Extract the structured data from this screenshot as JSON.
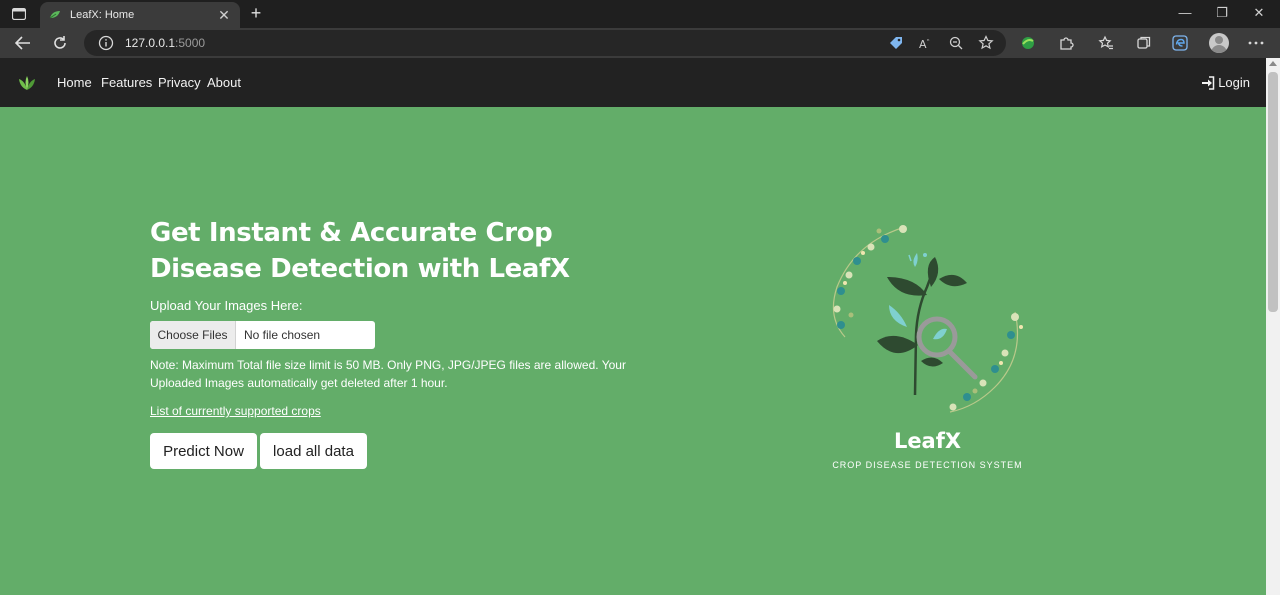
{
  "browser": {
    "tab_title": "LeafX: Home",
    "tab_close": "✕",
    "new_tab": "+",
    "url_host": "127.0.0.1",
    "url_port": ":5000",
    "window_controls": {
      "minimize": "—",
      "restore": "❐",
      "close": "✕"
    },
    "icons": [
      "tab-actions-icon",
      "back-arrow-icon",
      "refresh-icon",
      "site-info-icon",
      "tag-icon",
      "read-aloud-icon",
      "zoom-icon",
      "add-favorite-icon",
      "extension-icon",
      "puzzle-icon",
      "favorites-icon",
      "collections-icon",
      "edge-icon",
      "profile-icon",
      "more-icon"
    ]
  },
  "navbar": {
    "links": [
      "Home",
      "Features",
      "Privacy",
      "About"
    ],
    "login_label": "Login"
  },
  "hero": {
    "headline": "Get Instant & Accurate Crop Disease Detection with LeafX",
    "upload_label": "Upload Your Images Here:",
    "choose_files_label": "Choose Files",
    "file_status": "No file chosen",
    "note": "Note: Maximum Total file size limit is 50 MB. Only PNG, JPG/JPEG files are allowed. Your Uploaded Images automatically get deleted after 1 hour.",
    "crops_link": "List of currently supported crops",
    "predict_button": "Predict Now",
    "load_button": "load all data"
  },
  "logo": {
    "wordmark": "LeafX",
    "tagline": "CROP DISEASE DETECTION SYSTEM"
  },
  "colors": {
    "page_bg": "#63ad69",
    "navbar_bg": "#222222",
    "browser_chrome": "#3b3b3b",
    "tab_strip": "#1f1f1f",
    "plant_dark": "#2e4a30",
    "magnifier": "#9a9a9a"
  }
}
